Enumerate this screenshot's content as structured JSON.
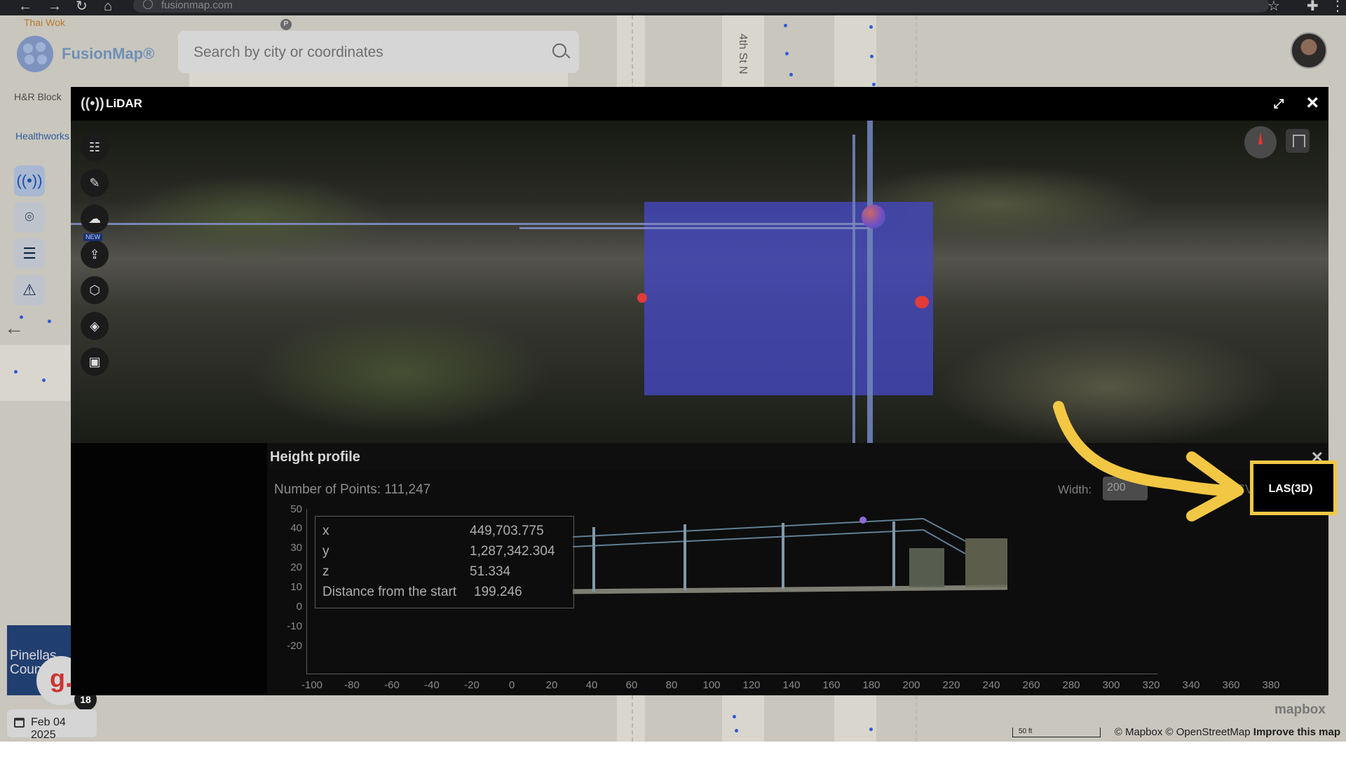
{
  "browser": {
    "url": "fusionmap.com"
  },
  "app": {
    "brand": "FusionMap®",
    "search": {
      "placeholder": "Search by city or coordinates"
    },
    "date": "Feb 04 2025",
    "badge_letter": "g.",
    "badge_count": "18",
    "map_labels": {
      "street": "4th St N",
      "poi1": "Thai Wok",
      "poi2": "H&R Block",
      "poi3": "Healthworks",
      "pinellas": "Pinellas Count",
      "parking": "P"
    },
    "attribution": {
      "scale": "50 ft",
      "credits": "© Mapbox © OpenStreetMap",
      "improve": "Improve this map",
      "mapbox": "mapbox"
    },
    "icons": {
      "search": "search-icon",
      "layers": "layers-icon",
      "back": "arrow-left-icon"
    }
  },
  "lidar": {
    "title": "LiDAR",
    "tools": [
      "sliders-icon",
      "wrench-icon",
      "cloud-icon",
      "upload-icon",
      "cube-icon",
      "layers-icon",
      "image-icon"
    ],
    "new_badge": "NEW",
    "height_profile": {
      "title": "Height profile",
      "points_label": "Number of Points:",
      "points_value": "111,247",
      "width_label": "Width:",
      "width_value": "200",
      "csv_label": "CSV(2D)",
      "las_label": "LAS(3D)",
      "tooltip": {
        "x_label": "x",
        "x_value": "449,703.775",
        "y_label": "y",
        "y_value": "1,287,342.304",
        "z_label": "z",
        "z_value": "51.334",
        "dist_label": "Distance from the start",
        "dist_value": "199.246"
      },
      "y_ticks": [
        "50",
        "40",
        "30",
        "20",
        "10",
        "0",
        "-10",
        "-20"
      ],
      "x_ticks": [
        "-100",
        "-80",
        "-60",
        "-40",
        "-20",
        "0",
        "20",
        "40",
        "60",
        "80",
        "100",
        "120",
        "140",
        "160",
        "180",
        "200",
        "220",
        "240",
        "260",
        "280",
        "300",
        "320",
        "340",
        "360",
        "380"
      ]
    }
  },
  "colors": {
    "accent": "#f2c744",
    "brand": "#1f4ea8",
    "overlay_blue": "#4447bc"
  }
}
